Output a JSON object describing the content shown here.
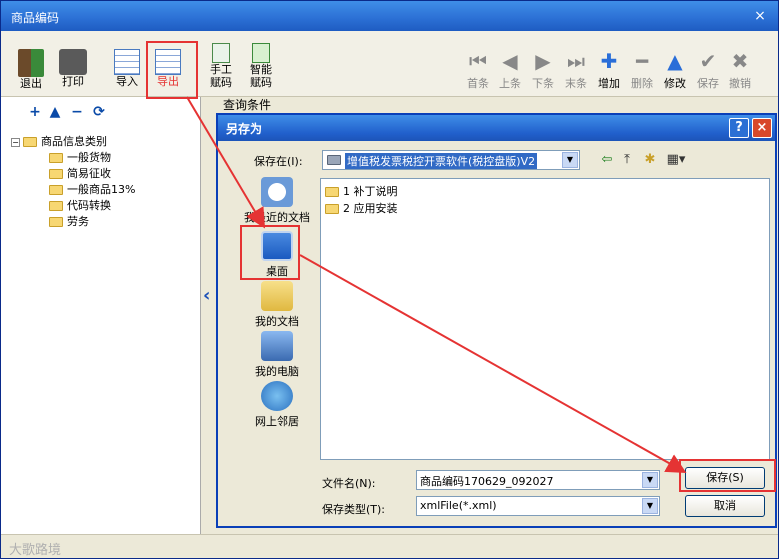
{
  "main": {
    "title": "商品编码",
    "close_glyph": "×"
  },
  "toolbar": {
    "exit": "退出",
    "print": "打印",
    "import": "导入",
    "export": "导出",
    "manual_code": "手工\n赋码",
    "smart_code": "智能\n赋码",
    "first": "首条",
    "prev": "上条",
    "next": "下条",
    "last": "末条",
    "add": "增加",
    "delete": "删除",
    "edit": "修改",
    "save": "保存",
    "cancel": "撤销"
  },
  "tree_tools": [
    "+",
    "▲",
    "−",
    "⟳"
  ],
  "tree": {
    "root": "商品信息类别",
    "children": [
      "一般货物",
      "简易征收",
      "一般商品13%",
      "代码转换",
      "劳务"
    ]
  },
  "query_label": "查询条件",
  "dialog": {
    "title": "另存为",
    "help": "?",
    "close": "×",
    "save_in_label": "保存在(I):",
    "save_in_value": "增值税发票税控开票软件(税控盘版)V2",
    "places": [
      "我最近的文档",
      "桌面",
      "我的文档",
      "我的电脑",
      "网上邻居"
    ],
    "files": [
      "1 补丁说明",
      "2 应用安装"
    ],
    "filename_label": "文件名(N):",
    "filename_value": "商品编码170629_092027",
    "filetype_label": "保存类型(T):",
    "filetype_value": "xmlFile(*.xml)",
    "save_button": "保存(S)",
    "cancel_button": "取消"
  },
  "watermark": "大歌路境",
  "colors": {
    "highlight": "#e53333",
    "title_blue": "#2b6fd4"
  }
}
